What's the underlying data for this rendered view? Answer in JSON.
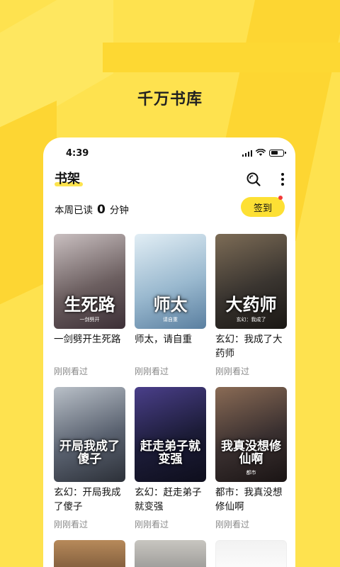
{
  "headline": "千万书库",
  "status_bar": {
    "time": "4:39"
  },
  "header": {
    "title": "书架"
  },
  "reading": {
    "prefix": "本周已读",
    "minutes": "0",
    "suffix": "分钟",
    "checkin_label": "签到"
  },
  "books": [
    {
      "name": "一剑劈开生死路",
      "status": "刚刚看过",
      "cover_text": "生死路",
      "cover_sub": "一剑劈开",
      "cover_colors": [
        "#6c5f60",
        "#c9bfc0",
        "#3c2f36"
      ]
    },
    {
      "name": "师太，请自重",
      "status": "刚刚看过",
      "cover_text": "师太",
      "cover_sub": "请自重",
      "cover_colors": [
        "#9ab9cf",
        "#e2eef5",
        "#5a7fa0"
      ]
    },
    {
      "name": "玄幻：我成了大药师",
      "status": "刚刚看过",
      "cover_text": "大药师",
      "cover_sub": "玄幻：我成了",
      "cover_colors": [
        "#3a3530",
        "#7d6c56",
        "#1a1714"
      ]
    },
    {
      "name": "玄幻：开局我成了傻子",
      "status": "刚刚看过",
      "cover_text": "开局我成了傻子",
      "cover_sub": "",
      "cover_colors": [
        "#5a6270",
        "#b9c0c8",
        "#2c3038"
      ]
    },
    {
      "name": "玄幻：赶走弟子就变强",
      "status": "刚刚看过",
      "cover_text": "赶走弟子就变强",
      "cover_sub": "",
      "cover_colors": [
        "#1c1c38",
        "#4a3f8a",
        "#0e0e1c"
      ]
    },
    {
      "name": "都市：我真没想修仙啊",
      "status": "刚刚看过",
      "cover_text": "我真没想修仙啊",
      "cover_sub": "都市",
      "cover_colors": [
        "#3a3030",
        "#8a6b55",
        "#1a1414"
      ]
    }
  ],
  "partial_covers": [
    {
      "cover_colors": [
        "#6a4a30",
        "#b78a5a"
      ]
    },
    {
      "cover_colors": [
        "#8a8a88",
        "#c8c6c0"
      ]
    },
    {
      "cover_colors": [
        "#ffffff",
        "#f2f2f2"
      ]
    }
  ]
}
